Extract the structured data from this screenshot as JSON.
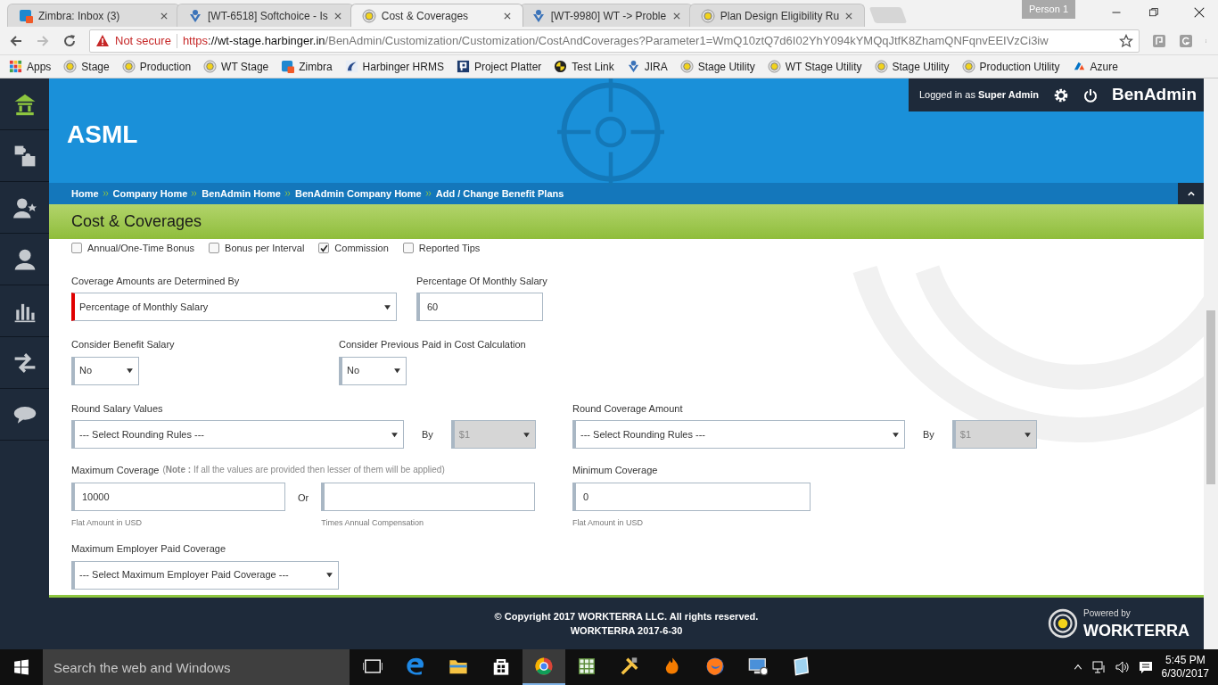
{
  "browser": {
    "tabs": [
      {
        "title": "Zimbra: Inbox (3)",
        "kind": "zimbra",
        "selected": false
      },
      {
        "title": "[WT-6518] Softchoice - Is",
        "kind": "jira",
        "selected": false
      },
      {
        "title": "Cost & Coverages",
        "kind": "site",
        "selected": true
      },
      {
        "title": "[WT-9980] WT -> Proble",
        "kind": "jira",
        "selected": false
      },
      {
        "title": "Plan Design Eligibility Ru",
        "kind": "site",
        "selected": false
      }
    ],
    "profile": "Person 1",
    "address": {
      "security": "Not secure",
      "scheme": "https",
      "host": "://wt-stage.harbinger.in",
      "path": "/BenAdmin/Customization/Customization/CostAndCoverages?Parameter1=WmQ10ztQ7d6I02YhY094kYMQqJtfK8ZhamQNFqnvEEIVzCi3iw"
    },
    "bookmarks": [
      {
        "label": "Apps",
        "kind": "apps"
      },
      {
        "label": "Stage",
        "kind": "site"
      },
      {
        "label": "Production",
        "kind": "site"
      },
      {
        "label": "WT Stage",
        "kind": "site"
      },
      {
        "label": "Zimbra",
        "kind": "zimbra"
      },
      {
        "label": "Harbinger HRMS",
        "kind": "hrms"
      },
      {
        "label": "Project Platter",
        "kind": "letter"
      },
      {
        "label": "Test Link",
        "kind": "testlink"
      },
      {
        "label": "JIRA",
        "kind": "jira"
      },
      {
        "label": "Stage Utility",
        "kind": "site"
      },
      {
        "label": "WT Stage Utility",
        "kind": "site"
      },
      {
        "label": "Stage Utility",
        "kind": "site"
      },
      {
        "label": "Production Utility",
        "kind": "site"
      },
      {
        "label": "Azure",
        "kind": "azure"
      }
    ]
  },
  "sidebar": {
    "items": [
      {
        "kind": "home",
        "selected": true
      },
      {
        "kind": "puzzle",
        "selected": false
      },
      {
        "kind": "user-star",
        "selected": false
      },
      {
        "kind": "user",
        "selected": false
      },
      {
        "kind": "chart",
        "selected": false
      },
      {
        "kind": "arrows",
        "selected": false
      },
      {
        "kind": "chat",
        "selected": false
      }
    ]
  },
  "header": {
    "company": "ASML",
    "logged_in": "Logged in as **Super Admin**",
    "brand": "BenAdmin",
    "breadcrumbs": [
      "Home",
      "Company Home",
      "BenAdmin Home",
      "BenAdmin Company Home",
      "Add / Change Benefit Plans"
    ]
  },
  "page_title": "Cost & Coverages",
  "form": {
    "checkboxes": [
      {
        "label": "Annual/One-Time Bonus",
        "checked": false
      },
      {
        "label": "Bonus per Interval",
        "checked": false
      },
      {
        "label": "Commission",
        "checked": true
      },
      {
        "label": "Reported Tips",
        "checked": false
      }
    ],
    "coverage_basis": {
      "label": "Coverage Amounts are Determined By",
      "value": "Percentage of Monthly Salary",
      "required": true
    },
    "percentage": {
      "label": "Percentage Of Monthly Salary",
      "value": "60"
    },
    "benefit_salary": {
      "label": "Consider Benefit Salary",
      "value": "No"
    },
    "previous_paid": {
      "label": "Consider Previous Paid in Cost Calculation",
      "value": "No"
    },
    "round_salary": {
      "label": "Round Salary Values",
      "value": "--- Select Rounding Rules ---",
      "by_label": "By",
      "by_value": "$1",
      "by_disabled": true
    },
    "round_coverage": {
      "label": "Round Coverage Amount",
      "value": "--- Select Rounding Rules ---",
      "by_label": "By",
      "by_value": "$1",
      "by_disabled": true
    },
    "max_coverage": {
      "label": "Maximum Coverage",
      "note": "(**Note :** If all the values are provided then lesser of them will be applied)",
      "flat_value": "10000",
      "flat_hint": "Flat Amount in USD",
      "or": "Or",
      "times_hint": "Times Annual Compensation"
    },
    "min_coverage": {
      "label": "Minimum Coverage",
      "value": "0",
      "hint": "Flat Amount in USD"
    },
    "max_employer": {
      "label": "Maximum Employer Paid Coverage",
      "value": "--- Select Maximum Employer Paid Coverage ---"
    }
  },
  "footer": {
    "copyright": "© Copyright 2017 WORKTERRA LLC. All rights reserved.",
    "version": "WORKTERRA 2017-6-30",
    "powered_by": "Powered by",
    "brand": "WORKTERRA"
  },
  "taskbar": {
    "search_placeholder": "Search the web and Windows",
    "apps": [
      {
        "kind": "task-view",
        "active": false
      },
      {
        "kind": "edge",
        "active": false
      },
      {
        "kind": "folder",
        "active": false
      },
      {
        "kind": "store",
        "active": false
      },
      {
        "kind": "chrome",
        "active": true
      },
      {
        "kind": "sheet",
        "active": false
      },
      {
        "kind": "tools",
        "active": false
      },
      {
        "kind": "flame",
        "active": false
      },
      {
        "kind": "firefox",
        "active": false
      },
      {
        "kind": "monitor",
        "active": false
      },
      {
        "kind": "notepad",
        "active": false
      }
    ],
    "time": "5:45 PM",
    "date": "6/30/2017"
  }
}
